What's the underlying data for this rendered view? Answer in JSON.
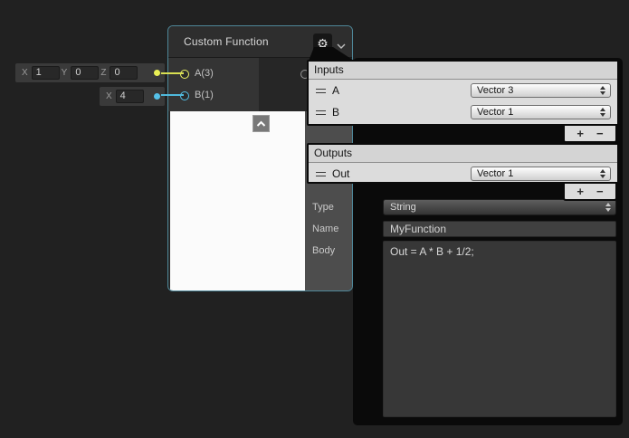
{
  "node": {
    "title": "Custom Function",
    "input_ports": [
      {
        "label": "A(3)",
        "color": "#EEF565"
      },
      {
        "label": "B(1)",
        "color": "#55C1E9"
      }
    ]
  },
  "widgets": {
    "vector3": {
      "fields": [
        {
          "label": "X",
          "value": "1"
        },
        {
          "label": "Y",
          "value": "0"
        },
        {
          "label": "Z",
          "value": "0"
        }
      ],
      "port_color": "#E9F055"
    },
    "vector1": {
      "fields": [
        {
          "label": "X",
          "value": "4"
        }
      ],
      "port_color": "#55C1E9"
    }
  },
  "settings": {
    "inputs": {
      "header": "Inputs",
      "rows": [
        {
          "label": "A",
          "type": "Vector 3"
        },
        {
          "label": "B",
          "type": "Vector 1"
        }
      ],
      "add_label": "+",
      "remove_label": "−"
    },
    "outputs": {
      "header": "Outputs",
      "rows": [
        {
          "label": "Out",
          "type": "Vector 1"
        }
      ],
      "add_label": "+",
      "remove_label": "−"
    },
    "type": {
      "label": "Type",
      "value": "String"
    },
    "name": {
      "label": "Name",
      "value": "MyFunction"
    },
    "body": {
      "label": "Body",
      "value": "Out = A * B + 1/2;"
    }
  },
  "icons": {
    "gear": "⚙"
  },
  "colors": {
    "editor_background": "#212121",
    "selection_border": "#4E8799",
    "vector3_port": "#EEF565",
    "vector1_port": "#55C1E9",
    "popup_background": "#0A0A0A",
    "panel_background": "#DCDCDC",
    "node_body": "#272727",
    "preview_background": "#FBFBFB"
  }
}
